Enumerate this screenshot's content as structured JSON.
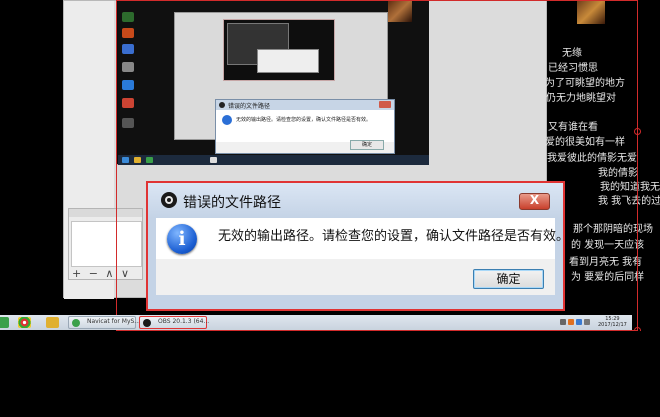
{
  "error_dialog": {
    "title": "错误的文件路径",
    "message": "无效的输出路径。请检查您的设置，确认文件路径是否有效。",
    "ok_label": "确定",
    "close_glyph": "X",
    "info_glyph": "i"
  },
  "inner_dialog": {
    "title": "错误的文件路径",
    "message": "无效的输出路径。请检查您的设置，确认文件路径是否有效。",
    "ok_label": "确定"
  },
  "sources_panel": {
    "tools": "+ − ∧ ∨"
  },
  "taskbar": {
    "tasks": [
      {
        "label": "Navicat for MyS..."
      },
      {
        "label": "OBS 20.1.3 (64..."
      }
    ],
    "clock_time": "15:29",
    "clock_date": "2017/12/17"
  },
  "poem": {
    "lines": [
      "无缘",
      "已经习惯思",
      "为了可眺望的地方",
      "仍无力地眺望对",
      "又有谁在看",
      "爱的很美如有一样",
      "我爱彼此的倩影无爱",
      "我的倩影",
      "我的知道我无法再相",
      "我 我飞去的过往",
      "那个那阴暗的现场",
      "的 发现一天应该",
      "看到月亮无 我有",
      "为 要爱的后同样"
    ]
  },
  "colors": {
    "accent_red": "#d22b2b",
    "dialog_frame": "#c4d3e6",
    "info_blue": "#1b5ed2",
    "close_red": "#c8402c"
  }
}
